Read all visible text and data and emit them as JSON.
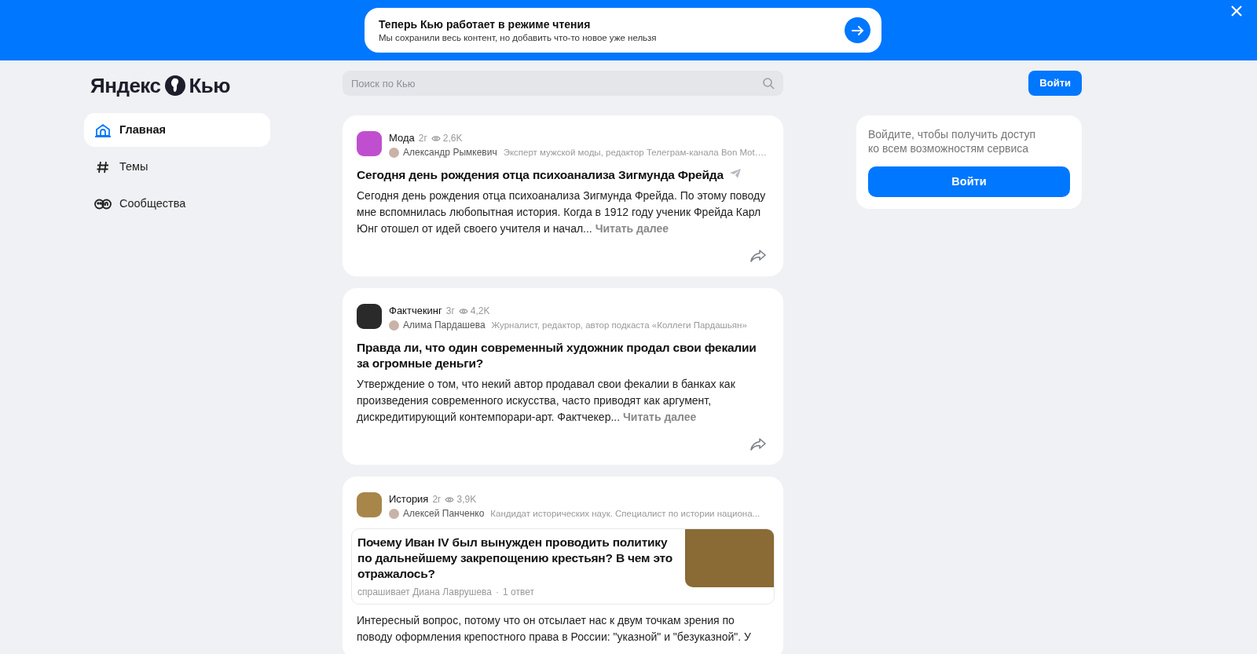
{
  "banner": {
    "title": "Теперь Кью работает в режиме чтения",
    "subtitle": "Мы сохранили весь контент, но добавить что-то новое уже нельзя"
  },
  "logo": {
    "left": "Яндекс",
    "right": "Кью"
  },
  "search": {
    "placeholder": "Поиск по Кью"
  },
  "login_button": "Войти",
  "nav": [
    {
      "kind": "home",
      "label": "Главная",
      "selected": true
    },
    {
      "kind": "hash",
      "label": "Темы",
      "selected": false
    },
    {
      "kind": "communities",
      "label": "Сообщества",
      "selected": false
    }
  ],
  "posts": [
    {
      "channel": "Мода",
      "age": "2г",
      "views": "2,6K",
      "author": "Александр Рымкевич",
      "author_about": "Эксперт мужской моды, редактор Телеграм-канала Bon Mot….",
      "title": "Сегодня день рождения отца психоанализа Зигмунда Фрейда",
      "telegram": true,
      "text": "Сегодня день рождения отца психоанализа Зигмунда Фрейда. По этому поводу мне вспомнилась любопытная история. Когда в 1912 году ученик Фрейда Карл Юнг отошел от идей своего учителя и начал...",
      "more": "Читать далее",
      "share": true
    },
    {
      "channel": "Фактчекинг",
      "age": "3г",
      "views": "4,2K",
      "author": "Алима Пардашева",
      "author_about": "Журналист, редактор, автор подкаста «Коллеги Пардашьян»",
      "title": "Правда ли, что один современный художник продал свои фекалии за огромные деньги?",
      "text": "Утверждение о том, что некий автор продавал свои фекалии в банках как произведения современного искусства, часто приводят как аргумент, дискредитирующий контемпорари-арт. Фактчекер...",
      "more": "Читать далее",
      "share": true
    },
    {
      "channel": "История",
      "age": "2г",
      "views": "3,9K",
      "author": "Алексей Панченко",
      "author_about": "Кандидат исторических наук. Специалист по истории национа...",
      "question": {
        "title": "Почему Иван IV был вынужден проводить политику по дальнейшему закрепощению крестьян? В чем это отражалось?",
        "asker": "спрашивает Диана Лаврушева",
        "separator": "·",
        "answers": "1 ответ"
      },
      "text": "Интересный вопрос, потому что он отсылает нас к двум точкам зрения по поводу оформления крепостного права в России: \"указной\" и \"безуказной\". У"
    }
  ],
  "login_card": {
    "text": "Войдите, чтобы получить доступ ко всем возможностям сервиса",
    "button": "Войти"
  }
}
